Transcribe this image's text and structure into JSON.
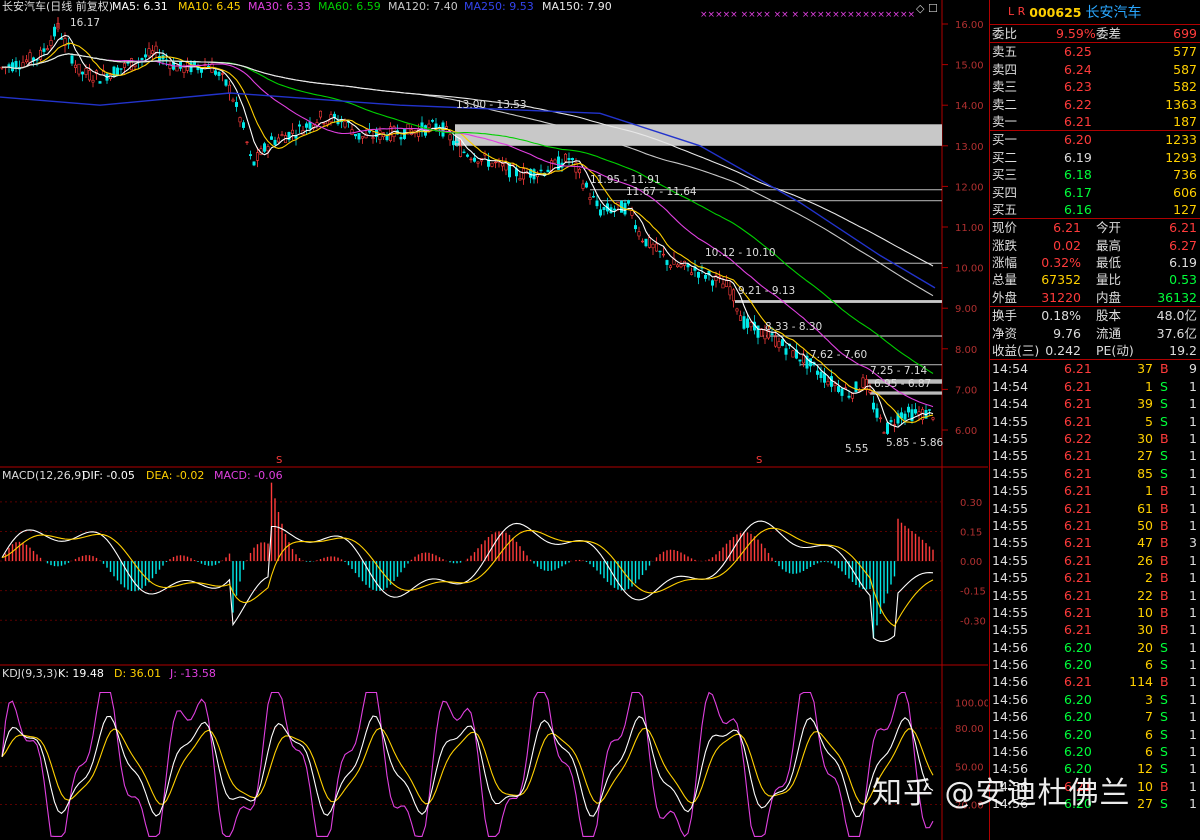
{
  "main_header": {
    "title": "长安汽车(日线 前复权)",
    "ma5": "MA5: 6.31",
    "ma10": "MA10: 6.45",
    "ma30": "MA30: 6.33",
    "ma60": "MA60: 6.59",
    "ma120": "MA120: 7.40",
    "ma250": "MA250: 9.53",
    "ma150": "MA150: 7.90"
  },
  "price_axis": [
    "16.00",
    "15.00",
    "14.00",
    "13.00",
    "12.00",
    "11.00",
    "10.00",
    "9.00",
    "8.00",
    "7.00",
    "6.00"
  ],
  "annotations": {
    "high": "16.17",
    "low": "5.55",
    "zones": [
      "13.00 - 13.53",
      "11.95 - 11.91",
      "11.67 - 11.64",
      "10.12 - 10.10",
      "9.21 - 9.13",
      "8.33 - 8.30",
      "7.62 - 7.60",
      "7.25 - 7.14",
      "6.95 - 6.87",
      "5.85 - 5.86"
    ]
  },
  "macd_header": {
    "title": "MACD(12,26,9)",
    "dif": "DIF: -0.05",
    "dea": "DEA: -0.02",
    "macd": "MACD: -0.06"
  },
  "macd_axis": [
    "0.30",
    "0.15",
    "0.00",
    "-0.15",
    "-0.30"
  ],
  "kdj_header": {
    "title": "KDJ(9,3,3)",
    "k": "K: 19.48",
    "d": "D: 36.01",
    "j": "J: -13.58"
  },
  "kdj_axis": [
    "100.00",
    "80.00",
    "50.00",
    "20.00"
  ],
  "quote": {
    "code": "000625",
    "name": "长安汽车",
    "weibi_label": "委比",
    "weibi": "9.59%",
    "weicha_label": "委差",
    "weicha": "699",
    "asks": [
      {
        "label": "卖五",
        "price": "6.25",
        "vol": "577"
      },
      {
        "label": "卖四",
        "price": "6.24",
        "vol": "587"
      },
      {
        "label": "卖三",
        "price": "6.23",
        "vol": "582"
      },
      {
        "label": "卖二",
        "price": "6.22",
        "vol": "1363"
      },
      {
        "label": "卖一",
        "price": "6.21",
        "vol": "187"
      }
    ],
    "bids": [
      {
        "label": "买一",
        "price": "6.20",
        "vol": "1233"
      },
      {
        "label": "买二",
        "price": "6.19",
        "vol": "1293"
      },
      {
        "label": "买三",
        "price": "6.18",
        "vol": "736"
      },
      {
        "label": "买四",
        "price": "6.17",
        "vol": "606"
      },
      {
        "label": "买五",
        "price": "6.16",
        "vol": "127"
      }
    ],
    "stats": [
      {
        "l1": "现价",
        "v1": "6.21",
        "l2": "今开",
        "v2": "6.21"
      },
      {
        "l1": "涨跌",
        "v1": "0.02",
        "l2": "最高",
        "v2": "6.27"
      },
      {
        "l1": "涨幅",
        "v1": "0.32%",
        "l2": "最低",
        "v2": "6.19"
      },
      {
        "l1": "总量",
        "v1": "67352",
        "l2": "量比",
        "v2": "0.53"
      },
      {
        "l1": "外盘",
        "v1": "31220",
        "l2": "内盘",
        "v2": "36132"
      }
    ],
    "stats2": [
      {
        "l1": "换手",
        "v1": "0.18%",
        "l2": "股本",
        "v2": "48.0亿"
      },
      {
        "l1": "净资",
        "v1": "9.76",
        "l2": "流通",
        "v2": "37.6亿"
      },
      {
        "l1": "收益(三)",
        "v1": "0.242",
        "l2": "PE(动)",
        "v2": "19.2"
      }
    ]
  },
  "ticks": [
    {
      "t": "14:54",
      "p": "6.21",
      "v": "37",
      "s": "B",
      "n": "9"
    },
    {
      "t": "14:54",
      "p": "6.21",
      "v": "1",
      "s": "S",
      "n": "1"
    },
    {
      "t": "14:54",
      "p": "6.21",
      "v": "39",
      "s": "S",
      "n": "1"
    },
    {
      "t": "14:55",
      "p": "6.21",
      "v": "5",
      "s": "S",
      "n": "1"
    },
    {
      "t": "14:55",
      "p": "6.22",
      "v": "30",
      "s": "B",
      "n": "1"
    },
    {
      "t": "14:55",
      "p": "6.21",
      "v": "27",
      "s": "S",
      "n": "1"
    },
    {
      "t": "14:55",
      "p": "6.21",
      "v": "85",
      "s": "S",
      "n": "1"
    },
    {
      "t": "14:55",
      "p": "6.21",
      "v": "1",
      "s": "B",
      "n": "1"
    },
    {
      "t": "14:55",
      "p": "6.21",
      "v": "61",
      "s": "B",
      "n": "1"
    },
    {
      "t": "14:55",
      "p": "6.21",
      "v": "50",
      "s": "B",
      "n": "1"
    },
    {
      "t": "14:55",
      "p": "6.21",
      "v": "47",
      "s": "B",
      "n": "3"
    },
    {
      "t": "14:55",
      "p": "6.21",
      "v": "26",
      "s": "B",
      "n": "1"
    },
    {
      "t": "14:55",
      "p": "6.21",
      "v": "2",
      "s": "B",
      "n": "1"
    },
    {
      "t": "14:55",
      "p": "6.21",
      "v": "22",
      "s": "B",
      "n": "1"
    },
    {
      "t": "14:55",
      "p": "6.21",
      "v": "10",
      "s": "B",
      "n": "1"
    },
    {
      "t": "14:55",
      "p": "6.21",
      "v": "30",
      "s": "B",
      "n": "1"
    },
    {
      "t": "14:56",
      "p": "6.20",
      "v": "20",
      "s": "S",
      "n": "1"
    },
    {
      "t": "14:56",
      "p": "6.20",
      "v": "6",
      "s": "S",
      "n": "1"
    },
    {
      "t": "14:56",
      "p": "6.21",
      "v": "114",
      "s": "B",
      "n": "1"
    },
    {
      "t": "14:56",
      "p": "6.20",
      "v": "3",
      "s": "S",
      "n": "1"
    },
    {
      "t": "14:56",
      "p": "6.20",
      "v": "7",
      "s": "S",
      "n": "1"
    },
    {
      "t": "14:56",
      "p": "6.20",
      "v": "6",
      "s": "S",
      "n": "1"
    },
    {
      "t": "14:56",
      "p": "6.20",
      "v": "6",
      "s": "S",
      "n": "1"
    },
    {
      "t": "14:56",
      "p": "6.20",
      "v": "12",
      "s": "S",
      "n": "1"
    },
    {
      "t": "14:56",
      "p": "6.21",
      "v": "10",
      "s": "B",
      "n": "1"
    },
    {
      "t": "14:56",
      "p": "6.20",
      "v": "27",
      "s": "S",
      "n": "1"
    }
  ],
  "watermark": "知乎 @安迪杜佛兰",
  "colors": {
    "up": "#ff3b3b",
    "down": "#00e8e8",
    "ma5": "#ffffff",
    "ma10": "#ffd000",
    "ma30": "#e040e0",
    "ma60": "#00d000",
    "ma120": "#c8c8c8",
    "ma250": "#2233cc",
    "ma150": "#e8e8e8"
  }
}
